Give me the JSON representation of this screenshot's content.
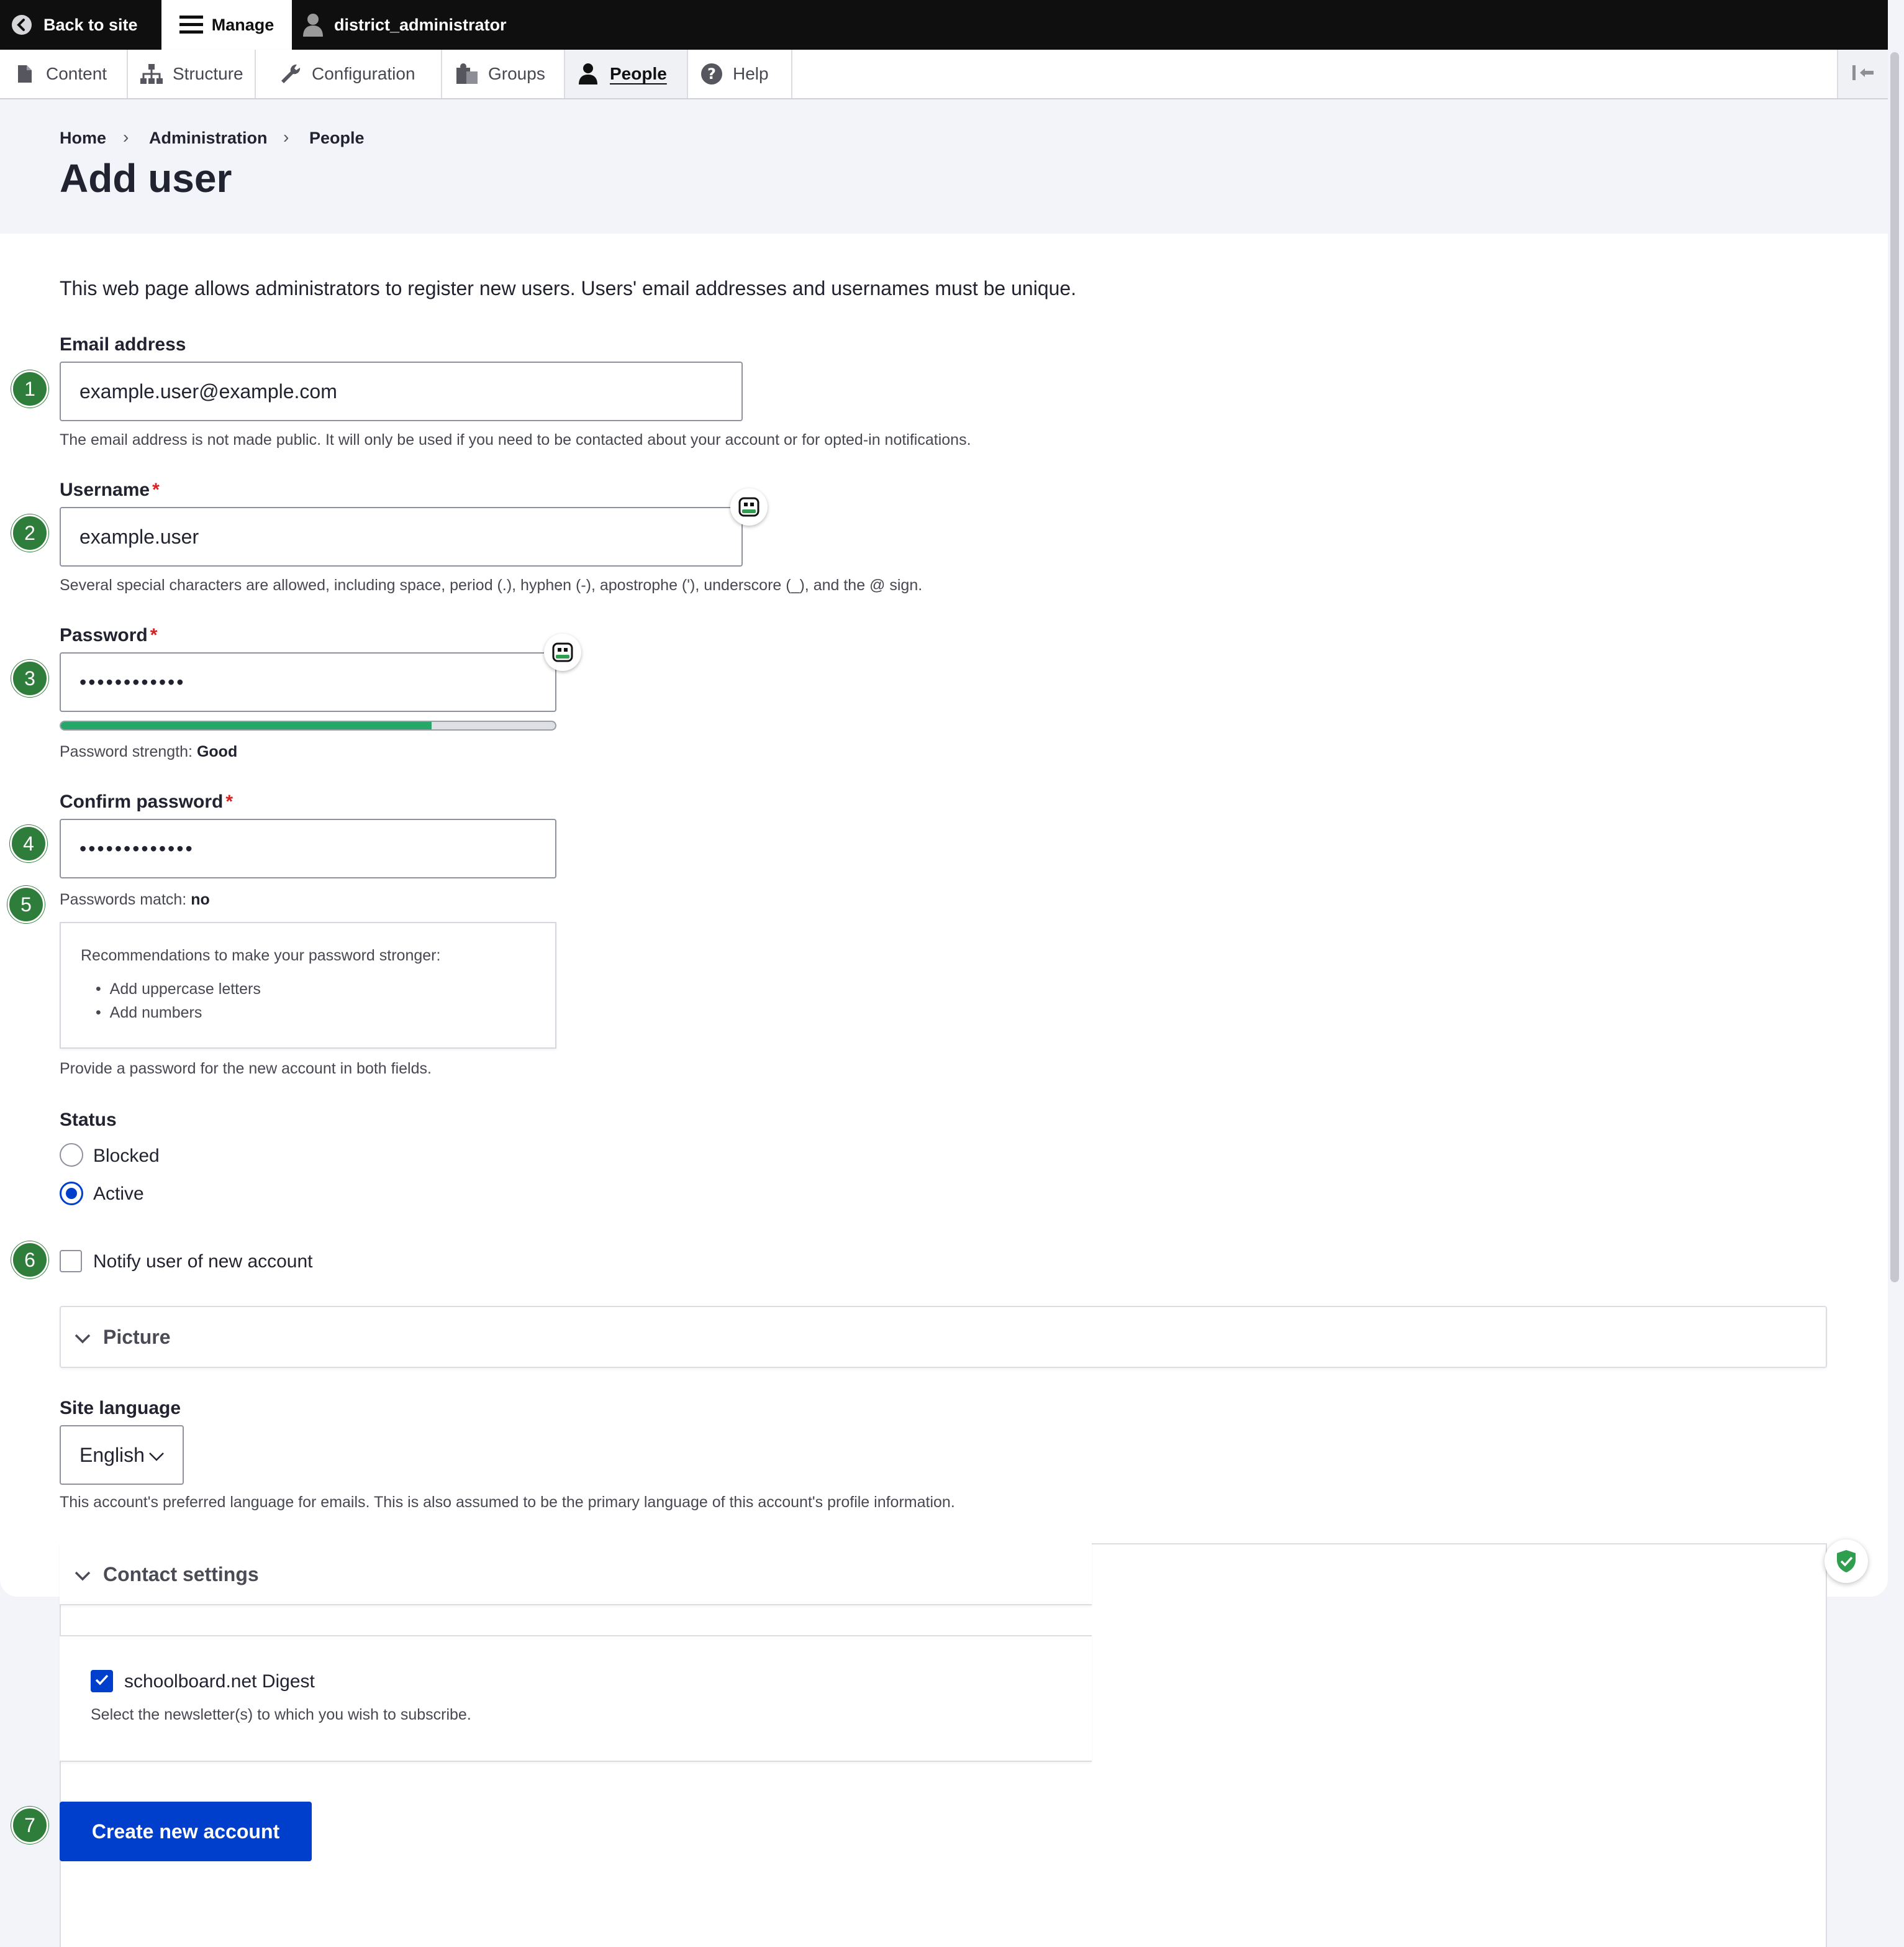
{
  "toolbar": {
    "back_label": "Back to site",
    "manage_label": "Manage",
    "user_label": "district_administrator"
  },
  "tabs": [
    {
      "label": "Content",
      "icon": "file-icon"
    },
    {
      "label": "Structure",
      "icon": "sitemap-icon"
    },
    {
      "label": "Configuration",
      "icon": "wrench-icon"
    },
    {
      "label": "Groups",
      "icon": "groups-icon"
    },
    {
      "label": "People",
      "icon": "person-icon",
      "active": true
    },
    {
      "label": "Help",
      "icon": "help-icon"
    }
  ],
  "breadcrumb": [
    "Home",
    "Administration",
    "People"
  ],
  "page_title": "Add user",
  "intro": "This web page allows administrators to register new users. Users' email addresses and usernames must be unique.",
  "form": {
    "email": {
      "label": "Email address",
      "value": "example.user@example.com",
      "description": "The email address is not made public. It will only be used if you need to be contacted about your account or for opted-in notifications."
    },
    "username": {
      "label": "Username",
      "required": "*",
      "value": "example.user",
      "description": "Several special characters are allowed, including space, period (.), hyphen (-), apostrophe ('), underscore (_), and the @ sign."
    },
    "password": {
      "label": "Password",
      "required": "*",
      "value": "••••••••••••",
      "strength_prefix": "Password strength:",
      "strength_value": "Good",
      "strength_fraction": 0.75
    },
    "confirm_password": {
      "label": "Confirm password",
      "required": "*",
      "value": "•••••••••••••",
      "match_prefix": "Passwords match:",
      "match_value": "no"
    },
    "recommendations": {
      "title": "Recommendations to make your password stronger:",
      "items": [
        "Add uppercase letters",
        "Add numbers"
      ]
    },
    "password_description": "Provide a password for the new account in both fields.",
    "status": {
      "label": "Status",
      "options": [
        {
          "label": "Blocked",
          "selected": false
        },
        {
          "label": "Active",
          "selected": true
        }
      ]
    },
    "notify": {
      "label": "Notify user of new account",
      "checked": false
    },
    "picture": {
      "label": "Picture"
    },
    "site_language": {
      "label": "Site language",
      "value": "English",
      "description": "This account's preferred language for emails. This is also assumed to be the primary language of this account's profile information."
    },
    "contact_settings": {
      "label": "Contact settings",
      "newsletter_label": "schoolboard.net Digest",
      "newsletter_checked": true,
      "newsletter_description": "Select the newsletter(s) to which you wish to subscribe."
    },
    "submit_label": "Create new account"
  },
  "step_badges": [
    "1",
    "2",
    "3",
    "4",
    "5",
    "6",
    "7"
  ],
  "colors": {
    "primary": "#003ecc",
    "badge": "#2f7d3a",
    "meter": "#26a769",
    "required": "#d72222"
  }
}
